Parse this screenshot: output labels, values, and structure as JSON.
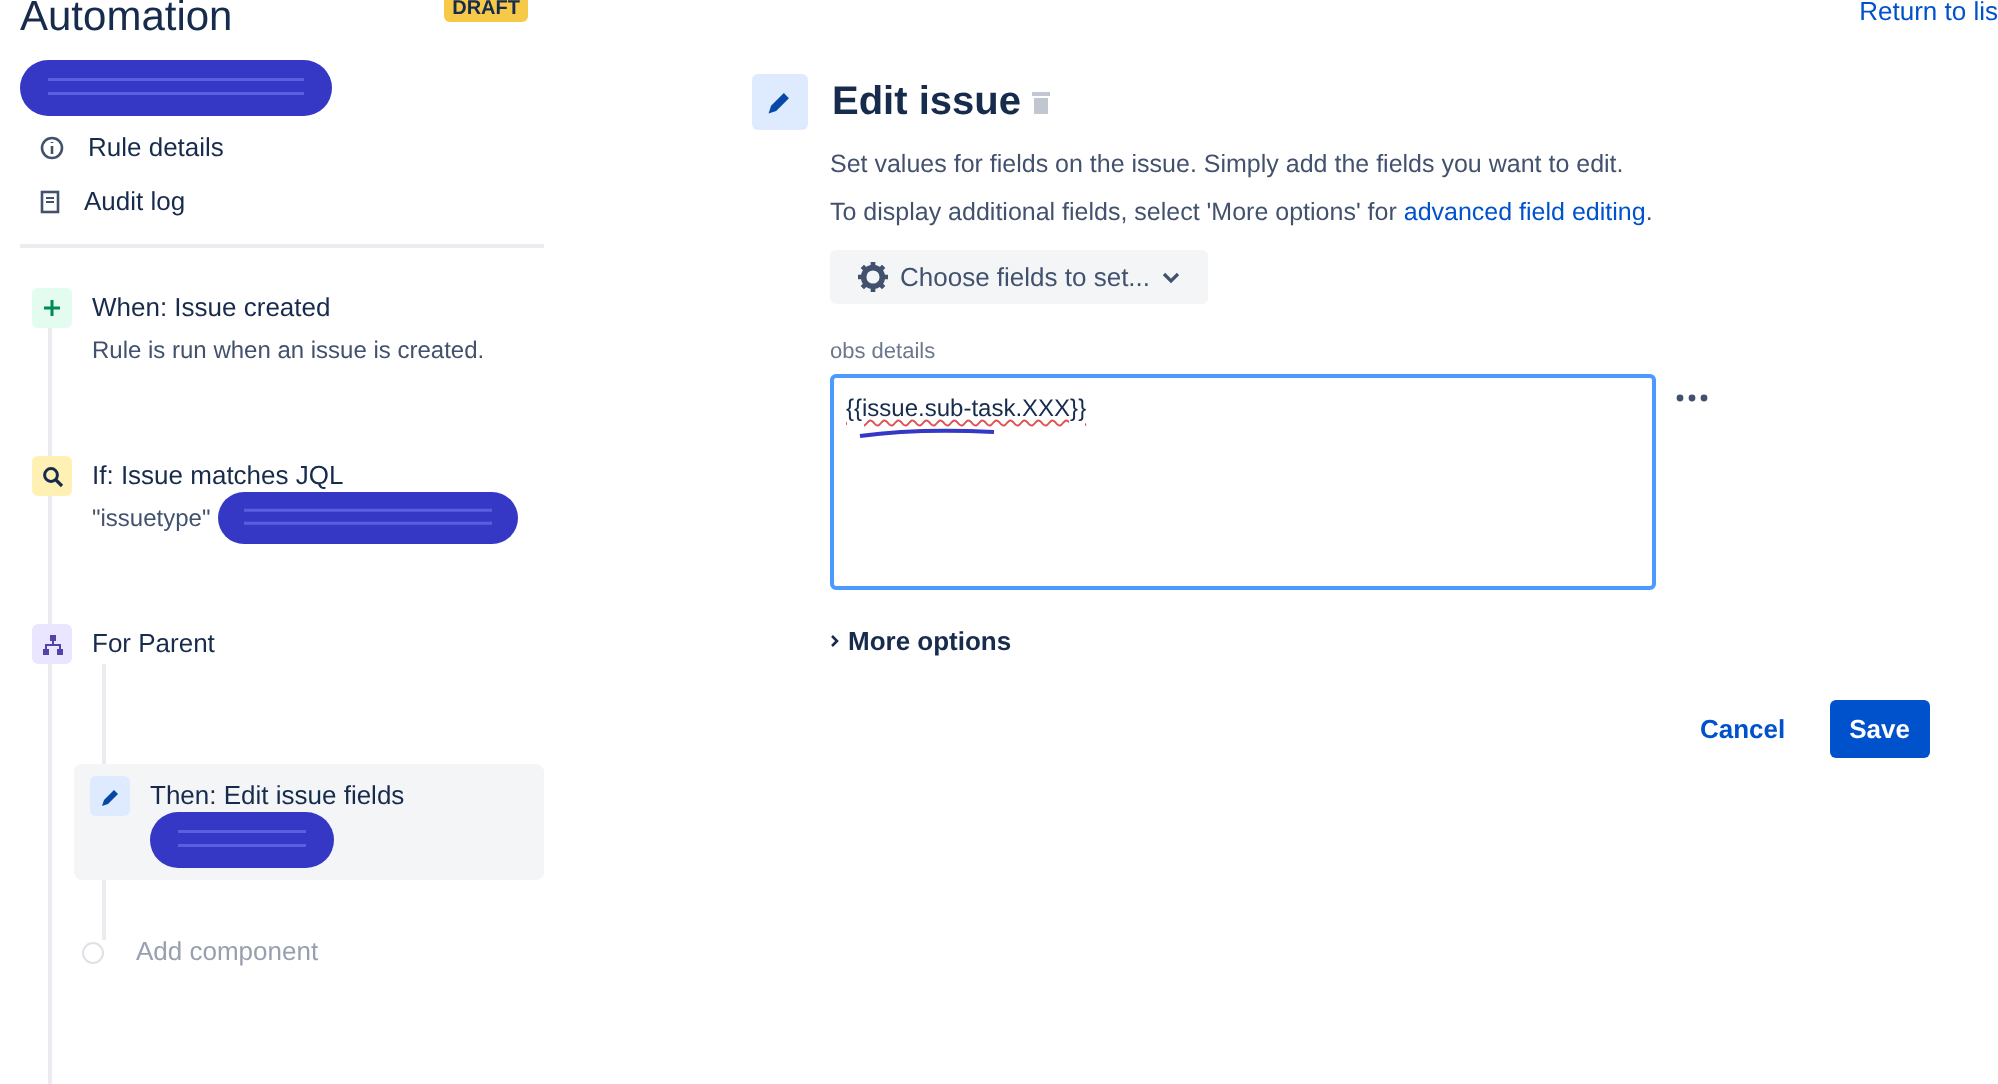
{
  "header": {
    "title": "Automation",
    "badge": "DRAFT",
    "return_link": "Return to lis"
  },
  "sidebar": {
    "nav": [
      {
        "kind": "info",
        "label": "Rule details"
      },
      {
        "kind": "log",
        "label": "Audit log"
      }
    ]
  },
  "steps": [
    {
      "kind": "trigger",
      "title": "When: Issue created",
      "subtitle": "Rule is run when an issue is created.",
      "selected": false
    },
    {
      "kind": "condition",
      "title": "If: Issue matches JQL",
      "subtitle": "\"issuetype\"",
      "redacted": true,
      "selected": false
    },
    {
      "kind": "branch",
      "title": "For Parent",
      "selected": false,
      "children": [
        {
          "kind": "action",
          "title": "Then: Edit issue fields",
          "redacted": true,
          "selected": true
        },
        {
          "kind": "add",
          "title": "Add component",
          "selected": false
        }
      ]
    }
  ],
  "editor": {
    "title": "Edit issue",
    "description": "Set values for fields on the issue. Simply add the fields you want to edit.",
    "hint": "To display additional fields, select 'More options' for ",
    "hint_link": "advanced field editing",
    "hint_end": ".",
    "choose_button": "Choose fields to set...",
    "field": {
      "label": "obs details",
      "value": "{{issue.sub-task.XXX}}"
    },
    "more_options": "More options",
    "cancel": "Cancel",
    "save": "Save"
  }
}
